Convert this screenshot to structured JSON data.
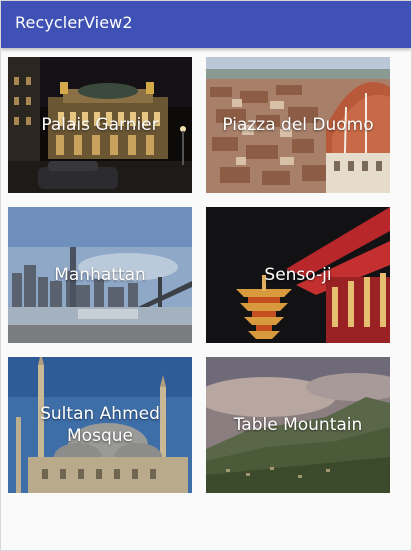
{
  "app_bar": {
    "title": "RecyclerView2",
    "color": "#3f51b5"
  },
  "cards": [
    {
      "title": "Palais Garnier"
    },
    {
      "title": "Piazza del Duomo"
    },
    {
      "title": "Manhattan"
    },
    {
      "title": "Senso-ji"
    },
    {
      "title": "Sultan Ahmed Mosque"
    },
    {
      "title": "Table Mountain"
    }
  ]
}
